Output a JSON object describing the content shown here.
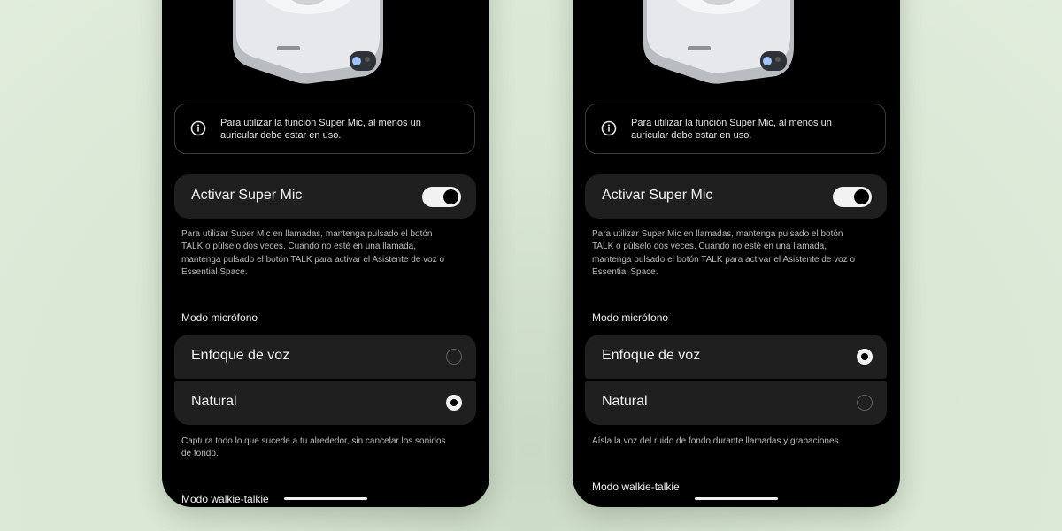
{
  "screens": [
    {
      "notice": "Para utilizar la función Super Mic, al menos un auricular debe estar en uso.",
      "toggle_label": "Activar Super Mic",
      "toggle_on": true,
      "toggle_description": "Para utilizar Super Mic en llamadas, mantenga pulsado el botón TALK o púlselo dos veces. Cuando no esté en una llamada, mantenga pulsado el botón TALK para activar el Asistente de voz o Essential Space.",
      "mic_mode_title": "Modo micrófono",
      "options": [
        {
          "label": "Enfoque de voz",
          "selected": false
        },
        {
          "label": "Natural",
          "selected": true
        }
      ],
      "option_description": "Captura todo lo que sucede a tu alrededor, sin cancelar los sonidos de fondo.",
      "walkie_title": "Modo walkie-talkie"
    },
    {
      "notice": "Para utilizar la función Super Mic, al menos un auricular debe estar en uso.",
      "toggle_label": "Activar Super Mic",
      "toggle_on": true,
      "toggle_description": "Para utilizar Super Mic en llamadas, mantenga pulsado el botón TALK o púlselo dos veces. Cuando no esté en una llamada, mantenga pulsado el botón TALK para activar el Asistente de voz o Essential Space.",
      "mic_mode_title": "Modo micrófono",
      "options": [
        {
          "label": "Enfoque de voz",
          "selected": true
        },
        {
          "label": "Natural",
          "selected": false
        }
      ],
      "option_description": "Aísla la voz del ruido de fondo durante llamadas y grabaciones.",
      "walkie_title": "Modo walkie-talkie"
    }
  ],
  "colors": {
    "background": "#dbe8d5",
    "phone": "#000000",
    "card": "#1f1f1f",
    "text": "#f2f2f2"
  }
}
